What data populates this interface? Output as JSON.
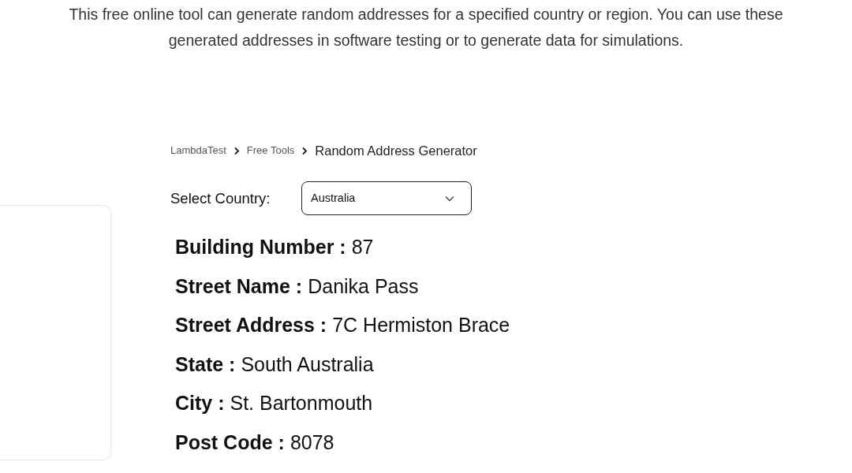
{
  "intro": "This free online tool can generate random addresses for a specified country or region. You can use these generated addresses in software testing or to generate data for simulations.",
  "breadcrumb": [
    {
      "label": "LambdaTest",
      "current": false
    },
    {
      "label": "Free Tools",
      "current": false
    },
    {
      "label": "Random Address Generator",
      "current": true
    }
  ],
  "country_select": {
    "label": "Select Country:",
    "value": "Australia"
  },
  "fields": [
    {
      "label": "Building Number :",
      "value": "87"
    },
    {
      "label": "Street Name :",
      "value": "Danika Pass"
    },
    {
      "label": "Street Address :",
      "value": "7C Hermiston Brace"
    },
    {
      "label": "State :",
      "value": "South Australia"
    },
    {
      "label": "City :",
      "value": "St. Bartonmouth"
    },
    {
      "label": "Post Code :",
      "value": "8078"
    }
  ]
}
